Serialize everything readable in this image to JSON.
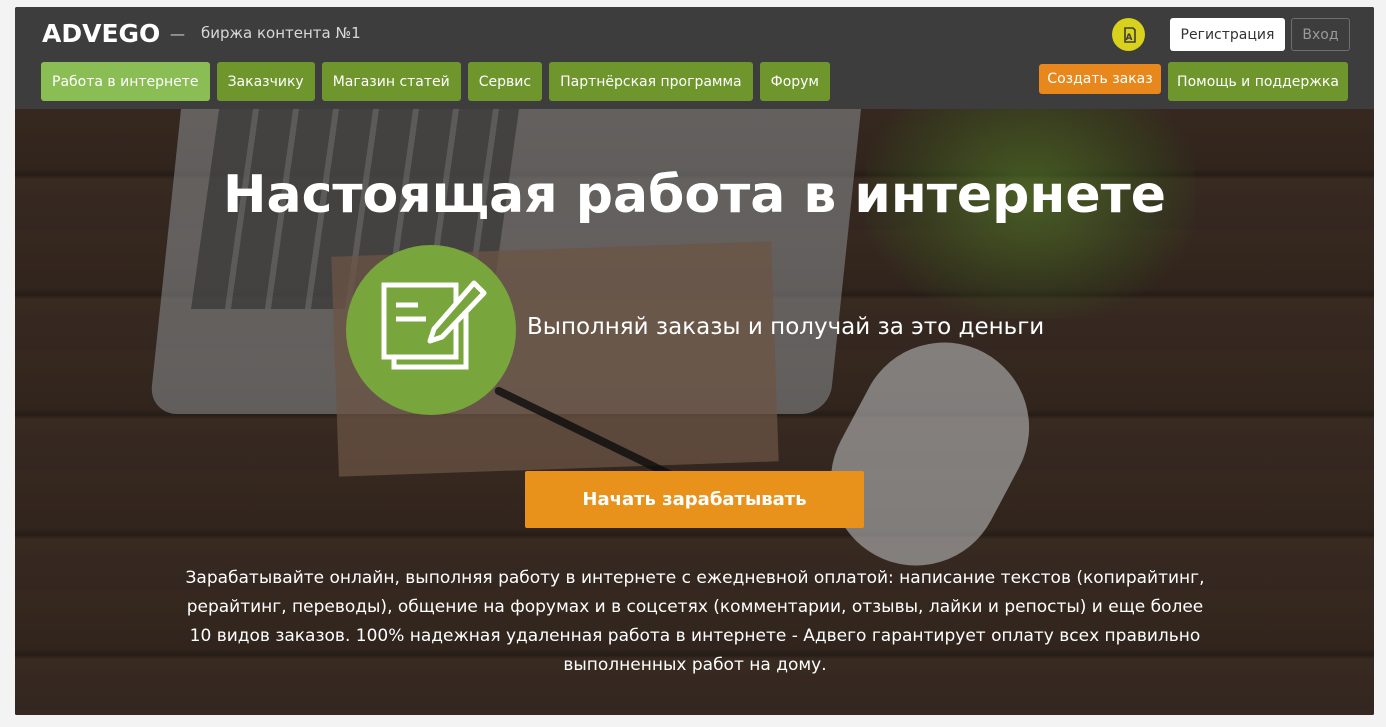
{
  "header": {
    "logo": "ADVEGO",
    "separator": "—",
    "tagline": "биржа контента №1",
    "register_label": "Регистрация",
    "login_label": "Вход",
    "create_order_label": "Создать заказ",
    "help_label": "Помощь и поддержка",
    "nav": [
      {
        "label": "Работа в интернете",
        "active": true
      },
      {
        "label": "Заказчику"
      },
      {
        "label": "Магазин статей"
      },
      {
        "label": "Сервис"
      },
      {
        "label": "Партнёрская программа"
      },
      {
        "label": "Форум"
      }
    ]
  },
  "hero": {
    "title": "Настоящая работа в интернете",
    "subtitle": "Выполняй заказы и получай за это деньги",
    "cta_label": "Начать зарабатывать",
    "description": "Зарабатывайте онлайн, выполняя работу в интернете с ежедневной оплатой: написание текстов (копирайтинг, рерайтинг, переводы), общение на форумах и в соцсетях (комментарии, отзывы, лайки и репосты) и еще более 10 видов заказов. 100% надежная удаленная работа в интернете - Адвего гарантирует оплату всех правильно выполненных работ на дому."
  },
  "icons": {
    "language": "translate-icon",
    "document_edit": "document-pencil-icon"
  },
  "colors": {
    "header_bg": "#3d3d3d",
    "nav_green": "#6e962c",
    "nav_active": "#8bbd55",
    "orange": "#e8921c",
    "circle_green": "#78a53c",
    "lang_yellow": "#d8d21c"
  }
}
